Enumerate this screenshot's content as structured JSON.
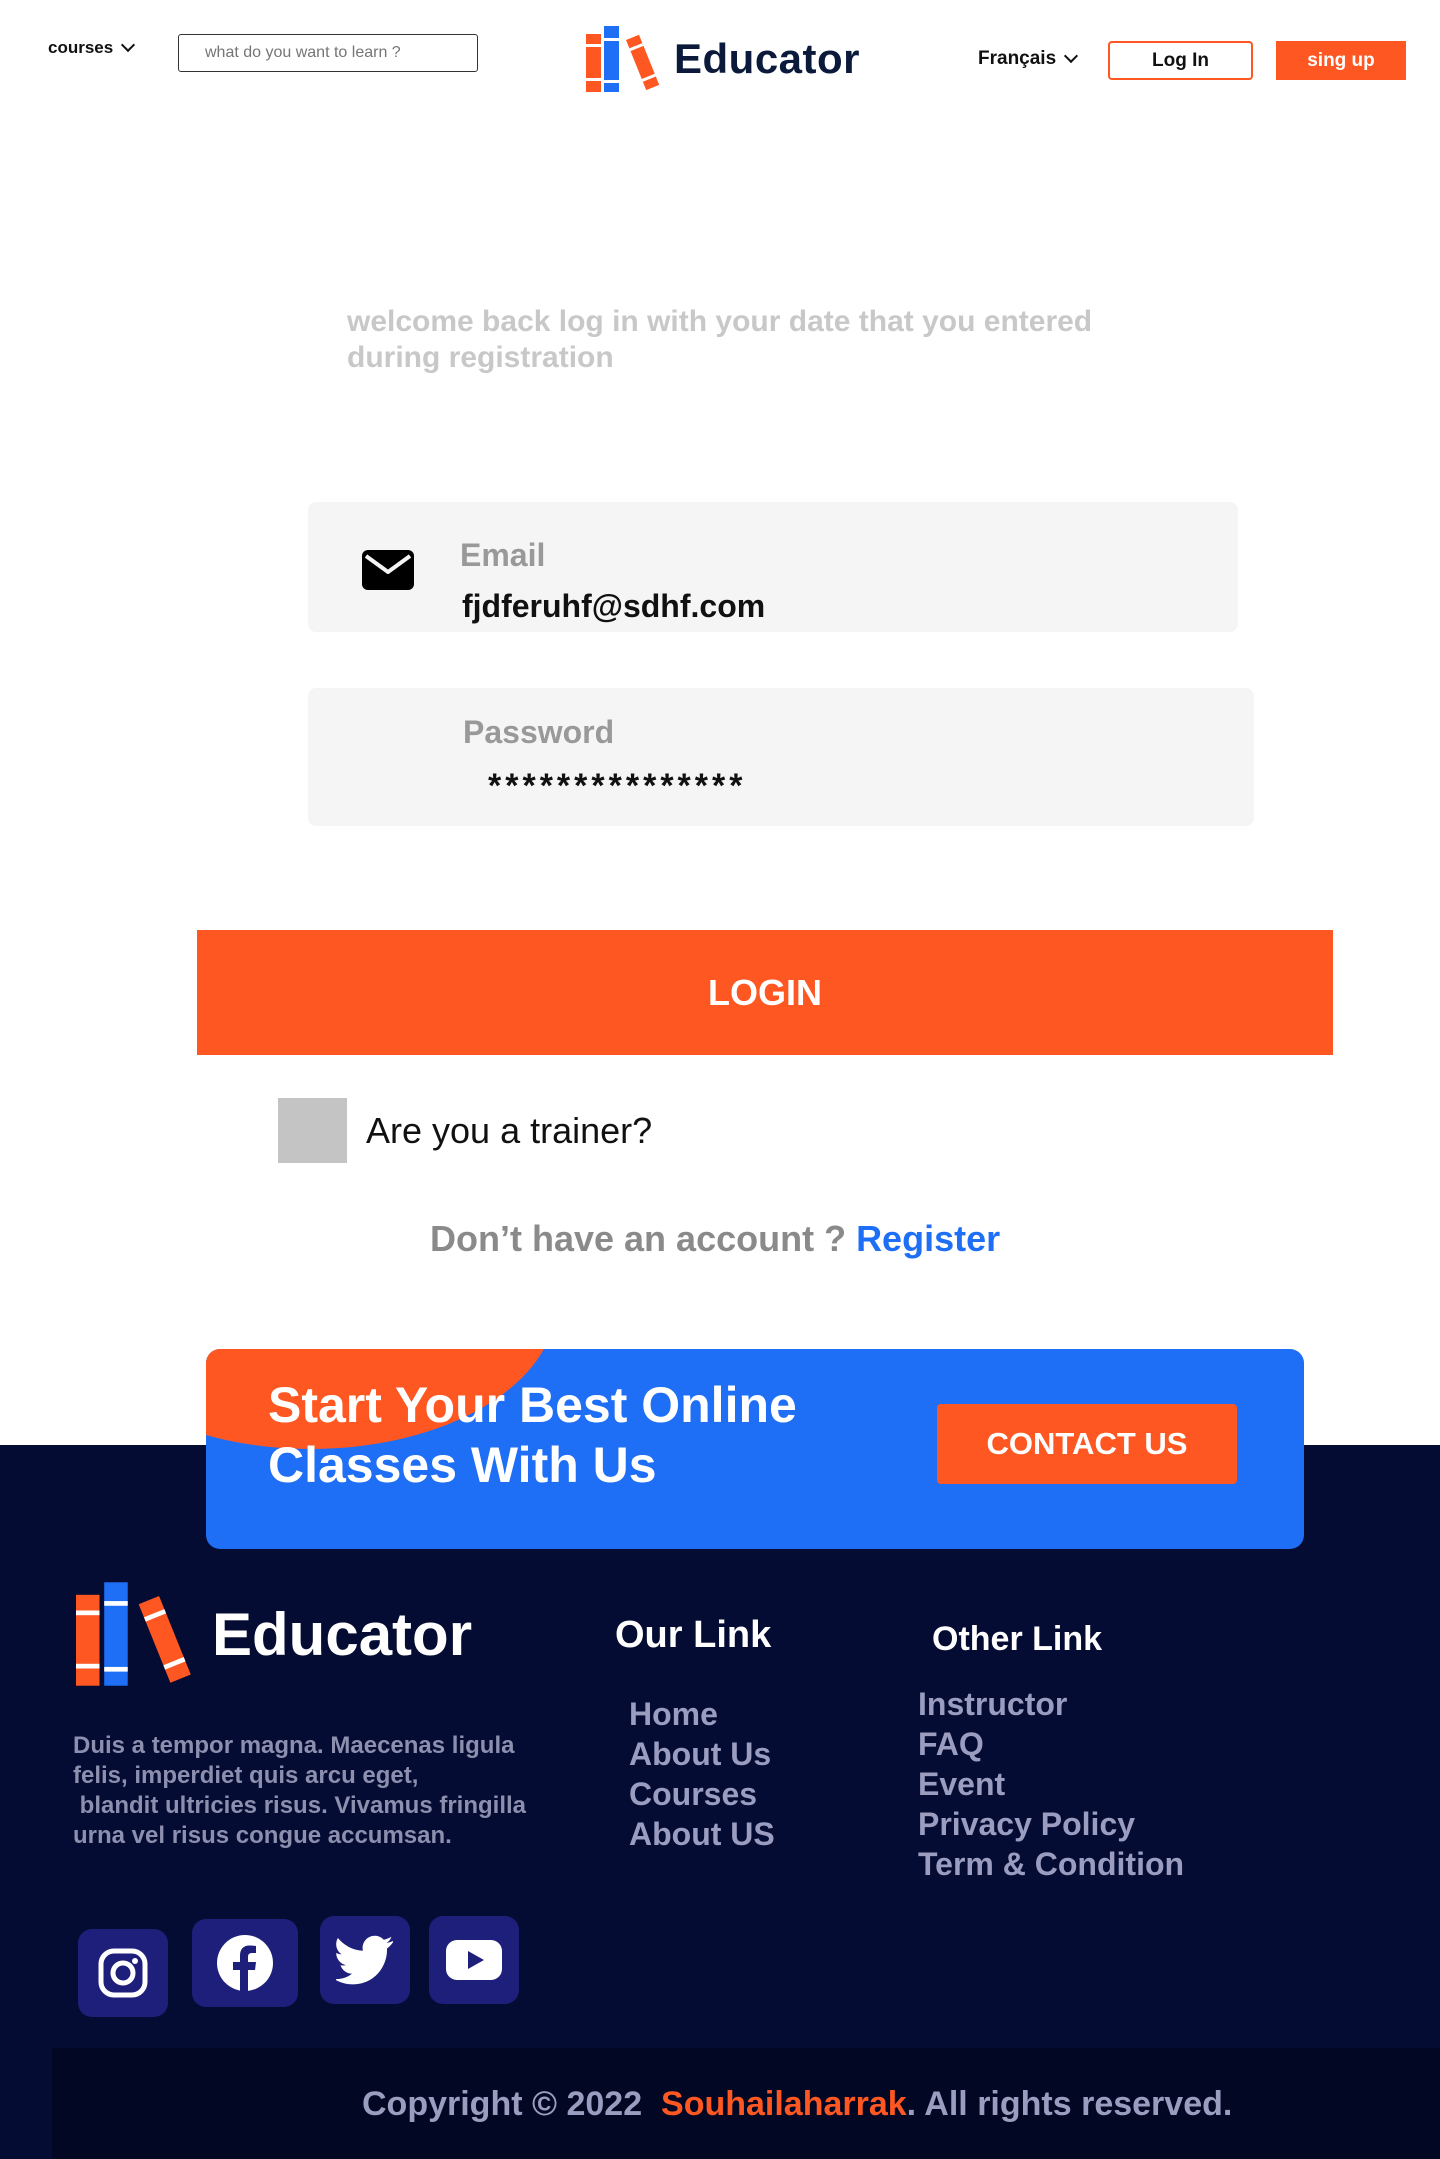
{
  "header": {
    "courses_label": "courses",
    "search_placeholder": "what do you want to learn ?",
    "brand": "Educator",
    "language": "Français",
    "login_label": "Log In",
    "signup_label": "sing up"
  },
  "login": {
    "welcome_line1": "welcome back log in with your date that you  entered",
    "welcome_line2": "during registration",
    "email_label": "Email",
    "email_value": "fjdferuhf@sdhf.com",
    "password_label": "Password",
    "password_mask": "***************",
    "login_button": "LOGIN",
    "trainer_label": "Are you a trainer?",
    "no_account_text": "Don’t  have an  account ? ",
    "register_link": "Register"
  },
  "cta": {
    "line1": "Start Your Best Online",
    "line2": "Classes With Us",
    "contact_button": "CONTACT US"
  },
  "footer": {
    "brand": "Educator",
    "description": [
      "Duis a tempor magna. Maecenas ligula",
      "felis, imperdiet quis arcu eget,",
      " blandit ultricies risus. Vivamus fringilla",
      "urna vel risus congue accumsan."
    ],
    "our_link_heading": "Our Link",
    "our_links": [
      "Home",
      "About Us",
      "Courses",
      "About US"
    ],
    "other_link_heading": "Other Link",
    "other_links": [
      "Instructor",
      "FAQ",
      "Event",
      "Privacy Policy",
      "Term & Condition"
    ],
    "social_icons": [
      "instagram-icon",
      "facebook-icon",
      "twitter-icon",
      "youtube-icon"
    ],
    "copyright_prefix": "Copyright © 2022  ",
    "copyright_brand": "Souhailaharrak",
    "copyright_suffix": ". All rights reserved."
  },
  "colors": {
    "accent_orange": "#ff5722",
    "primary_blue": "#1e6ff5",
    "footer_navy": "#050c33",
    "logo_navy": "#0b1a3b"
  }
}
